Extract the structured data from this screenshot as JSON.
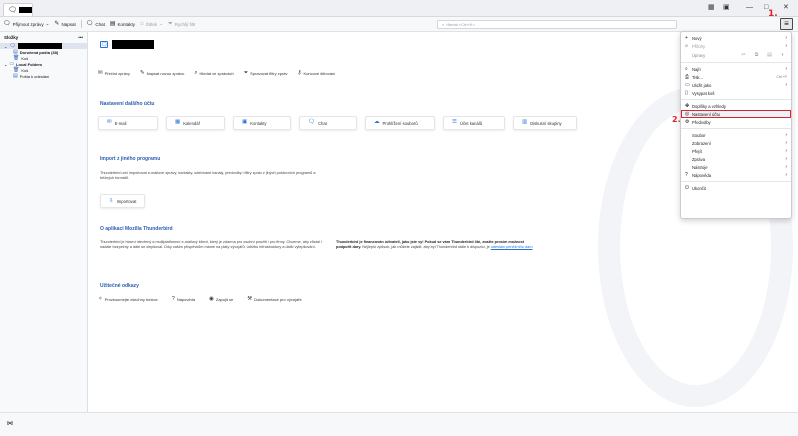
{
  "window": {
    "tab_glyph": "🗨",
    "min_glyph": "—",
    "close_glyph": "✕",
    "icons": [
      "calendar-icon",
      "tasks-icon",
      "minimize-icon",
      "maximize-icon",
      "close-icon"
    ]
  },
  "toolbar": {
    "get_messages": "Přijmout zprávy",
    "write": "Napsat",
    "chat": "Chat",
    "contacts": "Kontakty",
    "tag": "Štítek",
    "quick_filter": "Rychlý filtr",
    "search_placeholder": "Hledat <Ctrl+K>",
    "menu_glyph": "≡"
  },
  "markers": {
    "first": "1.",
    "second": "2."
  },
  "folderpane": {
    "title": "Složky",
    "more": "•••",
    "items": [
      {
        "label": "Doručená pošta (38)"
      },
      {
        "label": "Koš"
      },
      {
        "label": "Local Folders"
      },
      {
        "label": "Koš"
      },
      {
        "label": "Pošta k odeslání"
      }
    ]
  },
  "main": {
    "actions": [
      {
        "label": "Přečíst zprávy",
        "icon": "envelope-icon"
      },
      {
        "label": "Napsat novou zprávu",
        "icon": "pencil-icon"
      },
      {
        "label": "Hledat ve zprávách",
        "icon": "search-icon"
      },
      {
        "label": "Spravovat filtry zpráv",
        "icon": "filter-icon"
      },
      {
        "label": "Koncové šifrování",
        "icon": "key-icon"
      }
    ],
    "setup_title": "Nastavení dalšího účtu",
    "setup_cards": [
      {
        "label": "E-mail",
        "icon": "email-icon"
      },
      {
        "label": "Kalendář",
        "icon": "calendar-icon"
      },
      {
        "label": "Kontakty",
        "icon": "contacts-icon"
      },
      {
        "label": "Chat",
        "icon": "chat-icon"
      },
      {
        "label": "Prohlížení souborů",
        "icon": "filelink-icon"
      },
      {
        "label": "Účet kanálů",
        "icon": "rss-icon"
      },
      {
        "label": "Diskusní skupiny",
        "icon": "newsgroup-icon"
      }
    ],
    "import_title": "Import z jiného programu",
    "import_text": "Thunderbird umí importovat e-mailové zprávy, kontakty, odebírané kanály, předvolby i filtry zpráv z jiných poštovních programů a běžných formátů.",
    "import_button": "Importovat",
    "about_title": "O aplikaci Mozilla Thunderbird",
    "about_text": "Thunderbird je hlavní otevřený a multiplatformní e-mailový klient, který je zdarma pro osobní použití i pro firmy. Chceme, aby zůstal i nadále bezpečný a dále se zlepšoval. Díky vašim příspěvkům máme na platy vývojářů, údržbu infrastruktury a další vylepšování.",
    "donate_bold": "Thunderbird je financován uživateli, jako jste vy! Pokud se vám Thunderbird líbí, zvažte prosím možnost podpořit dary.",
    "donate_text": " Nejlepší způsob, jak můžete zajistit, aby byl Thunderbird stále k dispozici, je ",
    "donate_link": "odeslání peněžního daru",
    "links_title": "Užitečné odkazy",
    "links": [
      {
        "label": "Prozkoumejte všechny funkce",
        "icon": "explore-icon"
      },
      {
        "label": "Nápověda",
        "icon": "help-icon"
      },
      {
        "label": "Zapojit se",
        "icon": "community-icon"
      },
      {
        "label": "Dokumentace pro vývojáře",
        "icon": "tools-icon"
      }
    ]
  },
  "statusbar": {
    "icon": "wifi-icon"
  },
  "appmenu": {
    "items": [
      {
        "label": "Nový",
        "arrow": true,
        "icon": "plus-icon"
      },
      {
        "label": "Přílohy",
        "arrow": true,
        "icon": "paperclip-icon",
        "disabled": true
      },
      {
        "label": "Úpravy",
        "type": "edit"
      },
      {
        "label": "Najít",
        "arrow": true,
        "icon": "search-icon"
      },
      {
        "label": "Tisk...",
        "shortcut": "Ctrl+P",
        "icon": "print-icon"
      },
      {
        "label": "Uložit jako",
        "arrow": true,
        "icon": "save-icon"
      },
      {
        "label": "Vysypat koš",
        "icon": "trash-icon"
      },
      {
        "label": "Doplňky a vzhledy",
        "icon": "puzzle-icon"
      },
      {
        "label": "Nastavení účtu",
        "icon": "account-settings-icon",
        "highlight": true
      },
      {
        "label": "Předvolby",
        "icon": "gear-icon"
      },
      {
        "label": "Soubor",
        "arrow": true
      },
      {
        "label": "Zobrazení",
        "arrow": true
      },
      {
        "label": "Přejít",
        "arrow": true
      },
      {
        "label": "Zpráva",
        "arrow": true
      },
      {
        "label": "Nástroje",
        "arrow": true
      },
      {
        "label": "Nápověda",
        "arrow": true,
        "icon": "help-icon"
      },
      {
        "label": "Ukončit",
        "icon": "power-icon"
      }
    ]
  }
}
